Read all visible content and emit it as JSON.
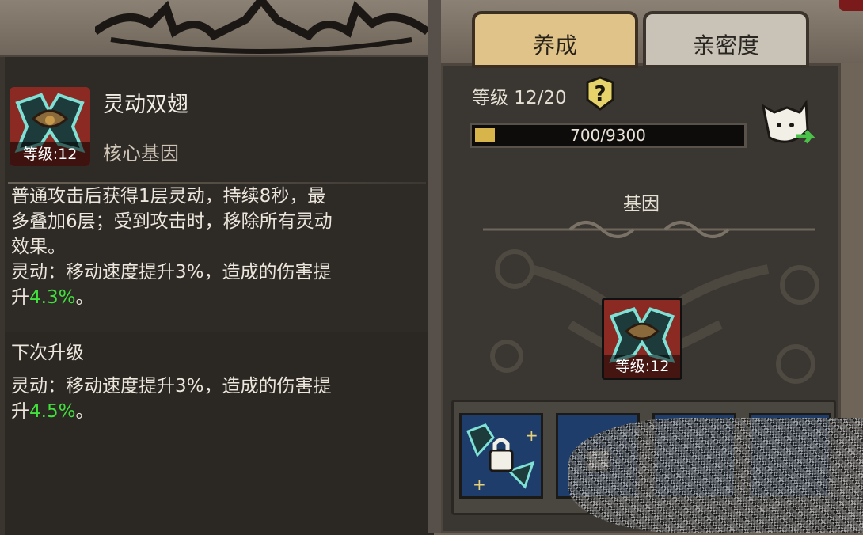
{
  "tabs": [
    {
      "label": "养成",
      "active": true
    },
    {
      "label": "亲密度",
      "active": false
    }
  ],
  "gene_detail": {
    "name": "灵动双翅",
    "type": "核心基因",
    "level_label": "等级:12",
    "description": [
      "普通攻击后获得1层灵动，持续8秒，最",
      "多叠加6层；受到攻击时，移除所有灵动",
      "效果。"
    ],
    "effect_prefix": "灵动：移动速度提升3%，造成的伤害提",
    "effect_line2_prefix": "升",
    "effect_value": "4.3%",
    "effect_suffix": "。",
    "next_title": "下次升级",
    "next_effect_prefix": "灵动：移动速度提升3%，造成的伤害提",
    "next_effect_line2_prefix": "升",
    "next_effect_value": "4.5%",
    "next_effect_suffix": "。"
  },
  "progress": {
    "level_text": "等级 12/20",
    "exp_text": "700/9300",
    "exp_fraction": 0.075
  },
  "gene_section": {
    "title": "基因",
    "center_level_label": "等级:12"
  },
  "colors": {
    "accent_green": "#41e03c",
    "tab_active": "#dfc389",
    "exp_fill": "#d7b54a"
  },
  "icons": [
    "help-icon",
    "cat-swap-icon",
    "lock-icon",
    "gene-wings-icon"
  ]
}
